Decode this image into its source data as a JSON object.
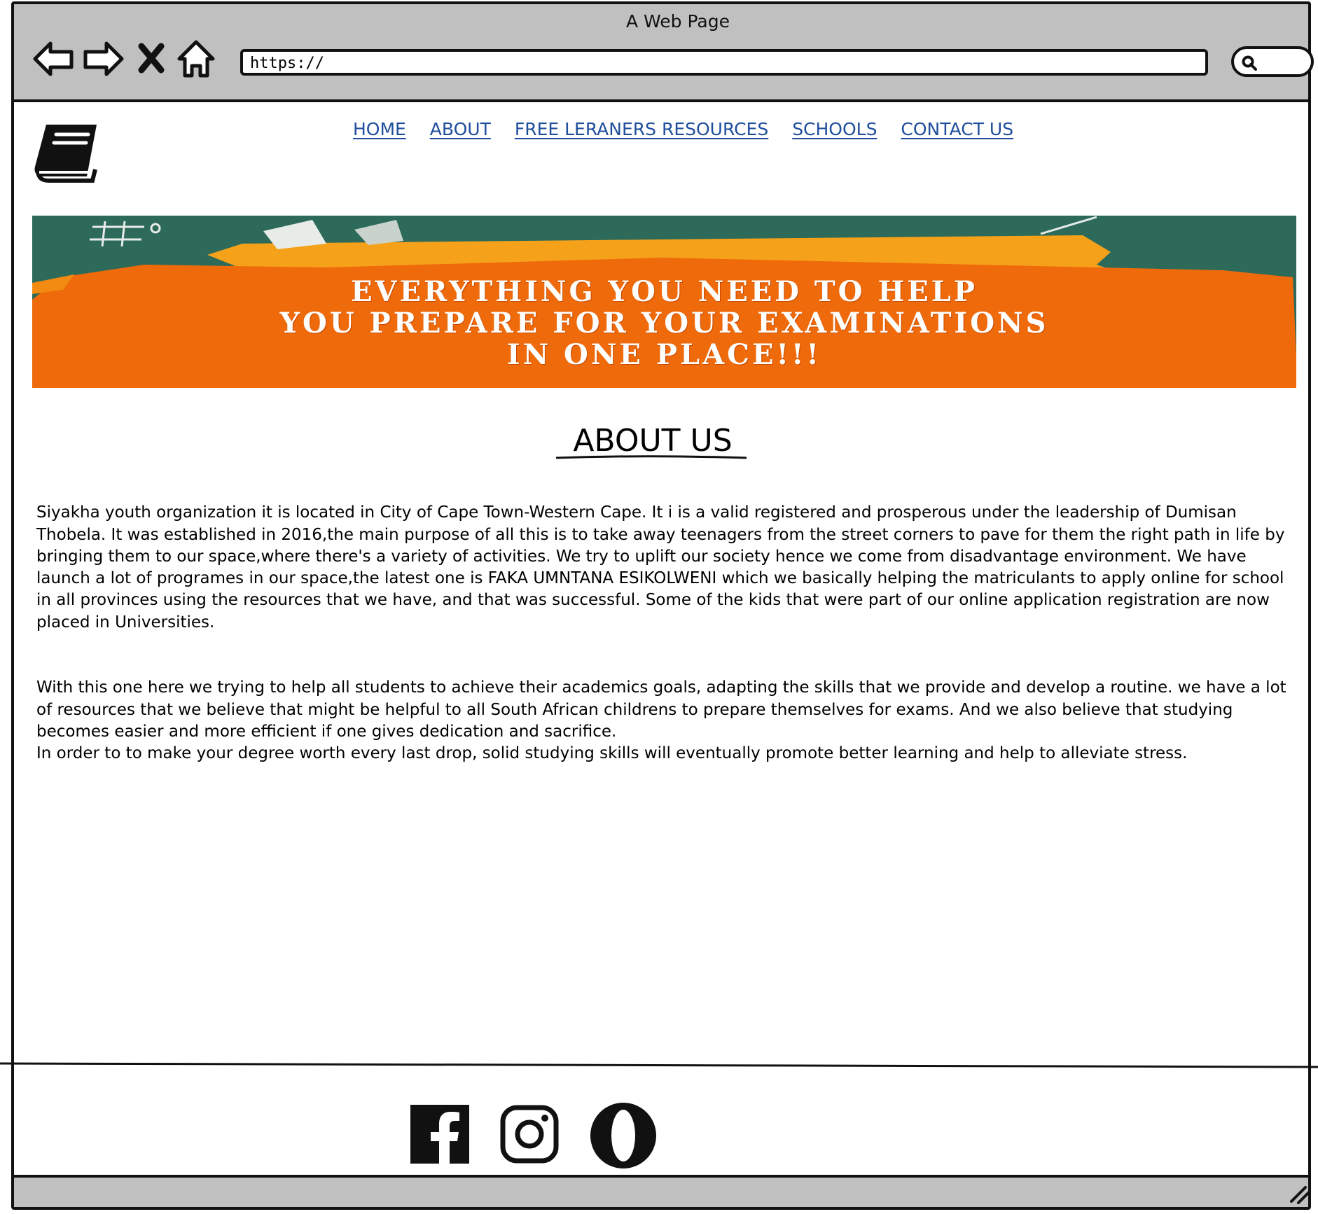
{
  "window": {
    "title": "A Web Page"
  },
  "browser": {
    "back_icon": "back-arrow-icon",
    "forward_icon": "forward-arrow-icon",
    "stop_icon": "close-icon",
    "home_icon": "home-icon",
    "url": "https://",
    "search_icon": "search-icon"
  },
  "site": {
    "logo_icon": "book-icon",
    "nav": [
      {
        "label": "HOME"
      },
      {
        "label": "ABOUT"
      },
      {
        "label": "FREE LERANERS RESOURCES"
      },
      {
        "label": "SCHOOLS"
      },
      {
        "label": "CONTACT US"
      }
    ],
    "nav_color": "#1f4e9d"
  },
  "banner": {
    "lines": [
      "EVERYTHING YOU NEED TO HELP",
      "YOU PREPARE FOR YOUR EXAMINATIONS",
      "IN ONE PLACE!!!"
    ],
    "colors": {
      "background": "#2d6a5a",
      "paint": "#ee6a0a",
      "paint_edge": "#f6a11a"
    }
  },
  "about": {
    "title": "ABOUT US",
    "paragraphs": [
      "Siyakha youth organization  it is located in City of Cape Town-Western Cape. It i is a valid registered and prosperous under the leadership of Dumisan Thobela. It was established in 2016,the main purpose of all this is to take away teenagers from the street corners to pave for them the right path in life by bringing them to our space,where there's a variety of activities. We try to uplift our society hence we come from disadvantage environment. We have launch a lot of  programes in our space,the latest one is FAKA UMNTANA ESIKOLWENI which we basically helping the matriculants to apply online for school in all provinces using the resources that we have, and that was successful. Some of the kids that were part of our online application registration are now placed in Universities.",
      "With this one here we trying to help all students to achieve their academics goals, adapting the skills that we provide and develop a routine. we have a lot of resources that we believe that might be helpful to all South African childrens to prepare themselves for exams. And we also believe that studying becomes easier and more efficient if one gives dedication and sacrifice.\nIn order to to make your degree worth every last drop, solid studying skills will eventually promote better learning and help to alleviate stress."
    ]
  },
  "footer": {
    "social": [
      {
        "icon": "facebook-icon"
      },
      {
        "icon": "instagram-icon"
      },
      {
        "icon": "opera-icon"
      }
    ]
  },
  "status": {
    "grip_icon": "resize-grip-icon"
  }
}
